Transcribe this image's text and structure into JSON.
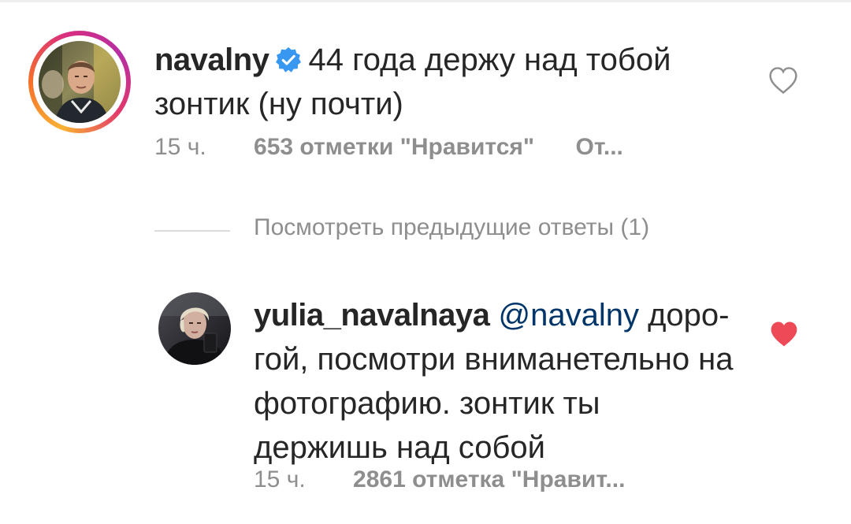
{
  "main_comment": {
    "username": "navalny",
    "text": "44 года держу над тобой зонтик (ну почти)",
    "time": "15 ч.",
    "likes": "653 отметки \"Нравится\"",
    "reply_label": "От...",
    "liked": false,
    "verified": true
  },
  "replies_toggle": {
    "label": "Посмотреть предыдущие ответы (1)"
  },
  "reply_comment": {
    "username": "yulia_navalnaya",
    "mention": "@navalny",
    "text": "доро-гой, посмотри вниманетельно на фотографию. зонтик ты держишь над собой",
    "time": "15 ч.",
    "likes": "2861 отметка \"Нравит...",
    "liked": true
  },
  "icons": {
    "verified": "verified-badge-icon",
    "like_empty": "heart-outline-icon",
    "like_filled": "heart-filled-icon"
  },
  "colors": {
    "verified_blue": "#3897f0",
    "like_red": "#ed4956",
    "secondary_text": "#8e8e8e",
    "mention_blue": "#003569"
  }
}
